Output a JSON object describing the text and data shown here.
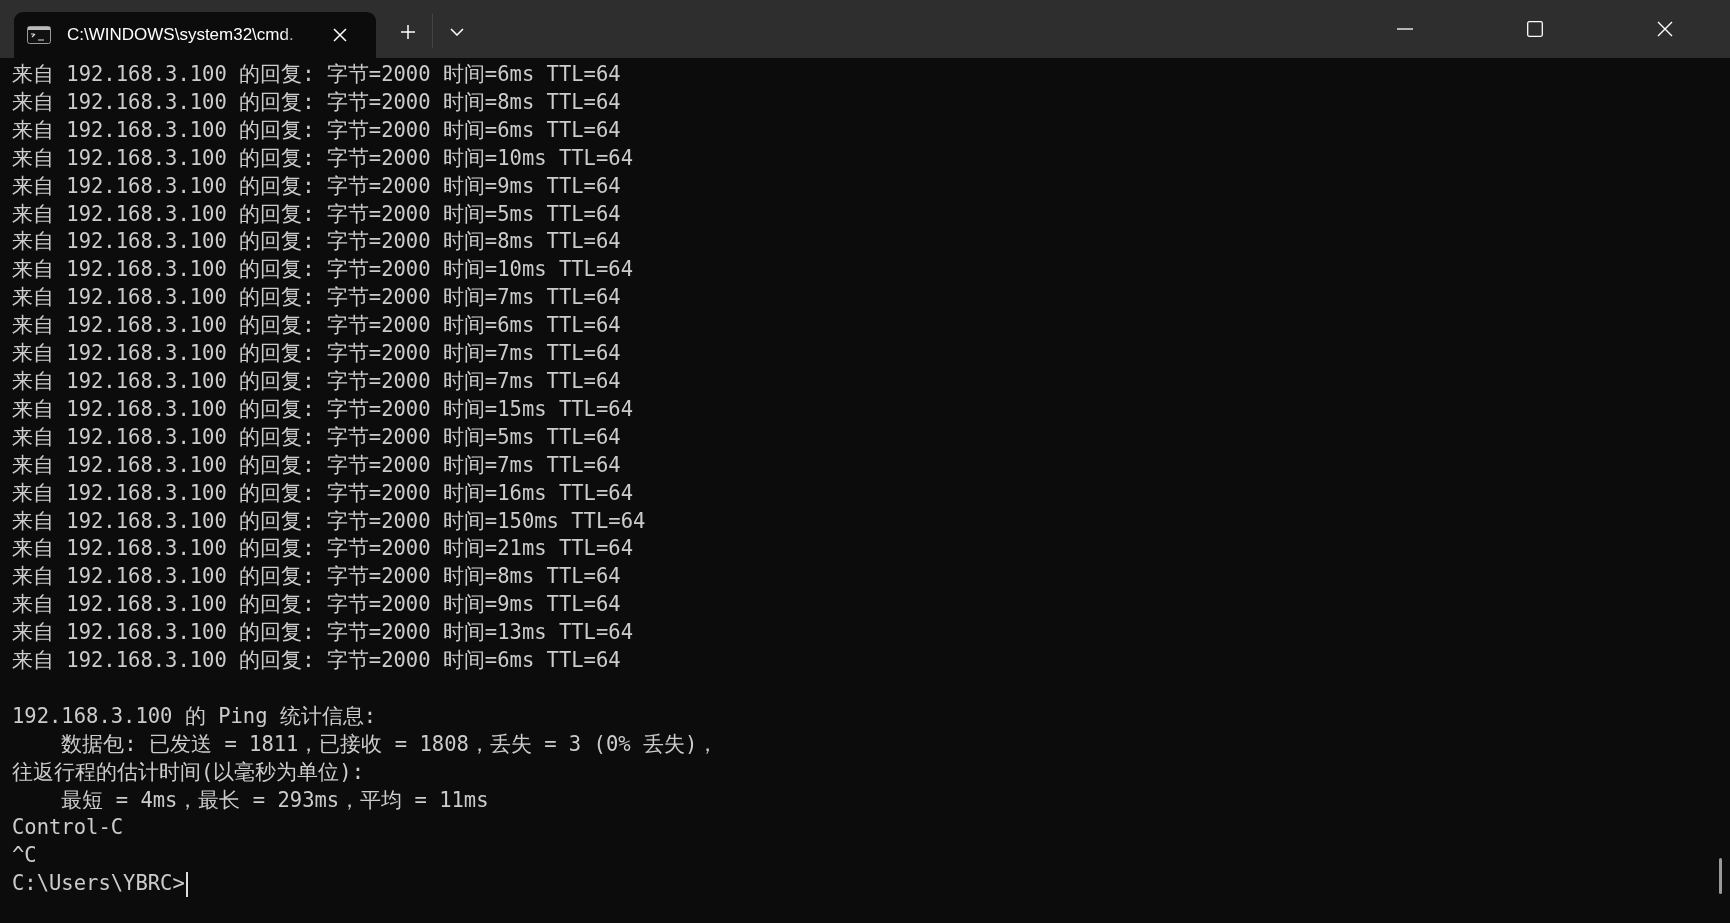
{
  "window": {
    "tab_title": "C:\\WINDOWS\\system32\\cmd."
  },
  "reply_lines": [
    "来自 192.168.3.100 的回复: 字节=2000 时间=6ms TTL=64",
    "来自 192.168.3.100 的回复: 字节=2000 时间=8ms TTL=64",
    "来自 192.168.3.100 的回复: 字节=2000 时间=6ms TTL=64",
    "来自 192.168.3.100 的回复: 字节=2000 时间=10ms TTL=64",
    "来自 192.168.3.100 的回复: 字节=2000 时间=9ms TTL=64",
    "来自 192.168.3.100 的回复: 字节=2000 时间=5ms TTL=64",
    "来自 192.168.3.100 的回复: 字节=2000 时间=8ms TTL=64",
    "来自 192.168.3.100 的回复: 字节=2000 时间=10ms TTL=64",
    "来自 192.168.3.100 的回复: 字节=2000 时间=7ms TTL=64",
    "来自 192.168.3.100 的回复: 字节=2000 时间=6ms TTL=64",
    "来自 192.168.3.100 的回复: 字节=2000 时间=7ms TTL=64",
    "来自 192.168.3.100 的回复: 字节=2000 时间=7ms TTL=64",
    "来自 192.168.3.100 的回复: 字节=2000 时间=15ms TTL=64",
    "来自 192.168.3.100 的回复: 字节=2000 时间=5ms TTL=64",
    "来自 192.168.3.100 的回复: 字节=2000 时间=7ms TTL=64",
    "来自 192.168.3.100 的回复: 字节=2000 时间=16ms TTL=64",
    "来自 192.168.3.100 的回复: 字节=2000 时间=150ms TTL=64",
    "来自 192.168.3.100 的回复: 字节=2000 时间=21ms TTL=64",
    "来自 192.168.3.100 的回复: 字节=2000 时间=8ms TTL=64",
    "来自 192.168.3.100 的回复: 字节=2000 时间=9ms TTL=64",
    "来自 192.168.3.100 的回复: 字节=2000 时间=13ms TTL=64",
    "来自 192.168.3.100 的回复: 字节=2000 时间=6ms TTL=64"
  ],
  "statistics_lines": [
    "192.168.3.100 的 Ping 统计信息:",
    "    数据包: 已发送 = 1811，已接收 = 1808，丢失 = 3 (0% 丢失)，",
    "往返行程的估计时间(以毫秒为单位):",
    "    最短 = 4ms，最长 = 293ms，平均 = 11ms",
    "Control-C",
    "^C"
  ],
  "prompt": "C:\\Users\\YBRC>"
}
